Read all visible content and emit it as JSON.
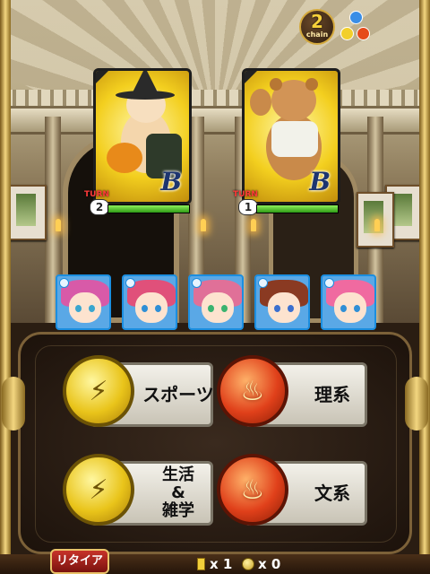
{
  "chain": {
    "count": "2",
    "label": "chain"
  },
  "enemies": [
    {
      "name_icon": "enemy-rabbit-witch",
      "rank": "B",
      "turn_label": "TURN",
      "turn": "2",
      "hp_fraction": 1.0
    },
    {
      "name_icon": "enemy-bear",
      "rank": "B",
      "turn_label": "TURN",
      "turn": "1",
      "hp_fraction": 1.0
    }
  ],
  "party": [
    {
      "hair": "#d85aa8",
      "eye": "#3aa6cf",
      "hp_fraction": 1.0
    },
    {
      "hair": "#e0507a",
      "eye": "#2f8fd6",
      "hp_fraction": 1.0
    },
    {
      "hair": "#e07098",
      "eye": "#3ab36f",
      "hp_fraction": 1.0
    },
    {
      "hair": "#8a3a22",
      "eye": "#3a6fcf",
      "hp_fraction": 1.0
    },
    {
      "hair": "#f06aa0",
      "eye": "#2f8fd6",
      "hp_fraction": 1.0
    }
  ],
  "answers": [
    {
      "label": "スポーツ",
      "orb": "yellow"
    },
    {
      "label": "理系",
      "orb": "red"
    },
    {
      "label": "生活\n&\n雑学",
      "orb": "yellow"
    },
    {
      "label": "文系",
      "orb": "red"
    }
  ],
  "footer": {
    "retire_label": "リタイア",
    "ticket_count": "x 1",
    "coin_count": "x 0"
  },
  "colors": {
    "accent_gold": "#d4a93c",
    "party_border": "#1b8ee0",
    "retire_red": "#c7332a"
  }
}
